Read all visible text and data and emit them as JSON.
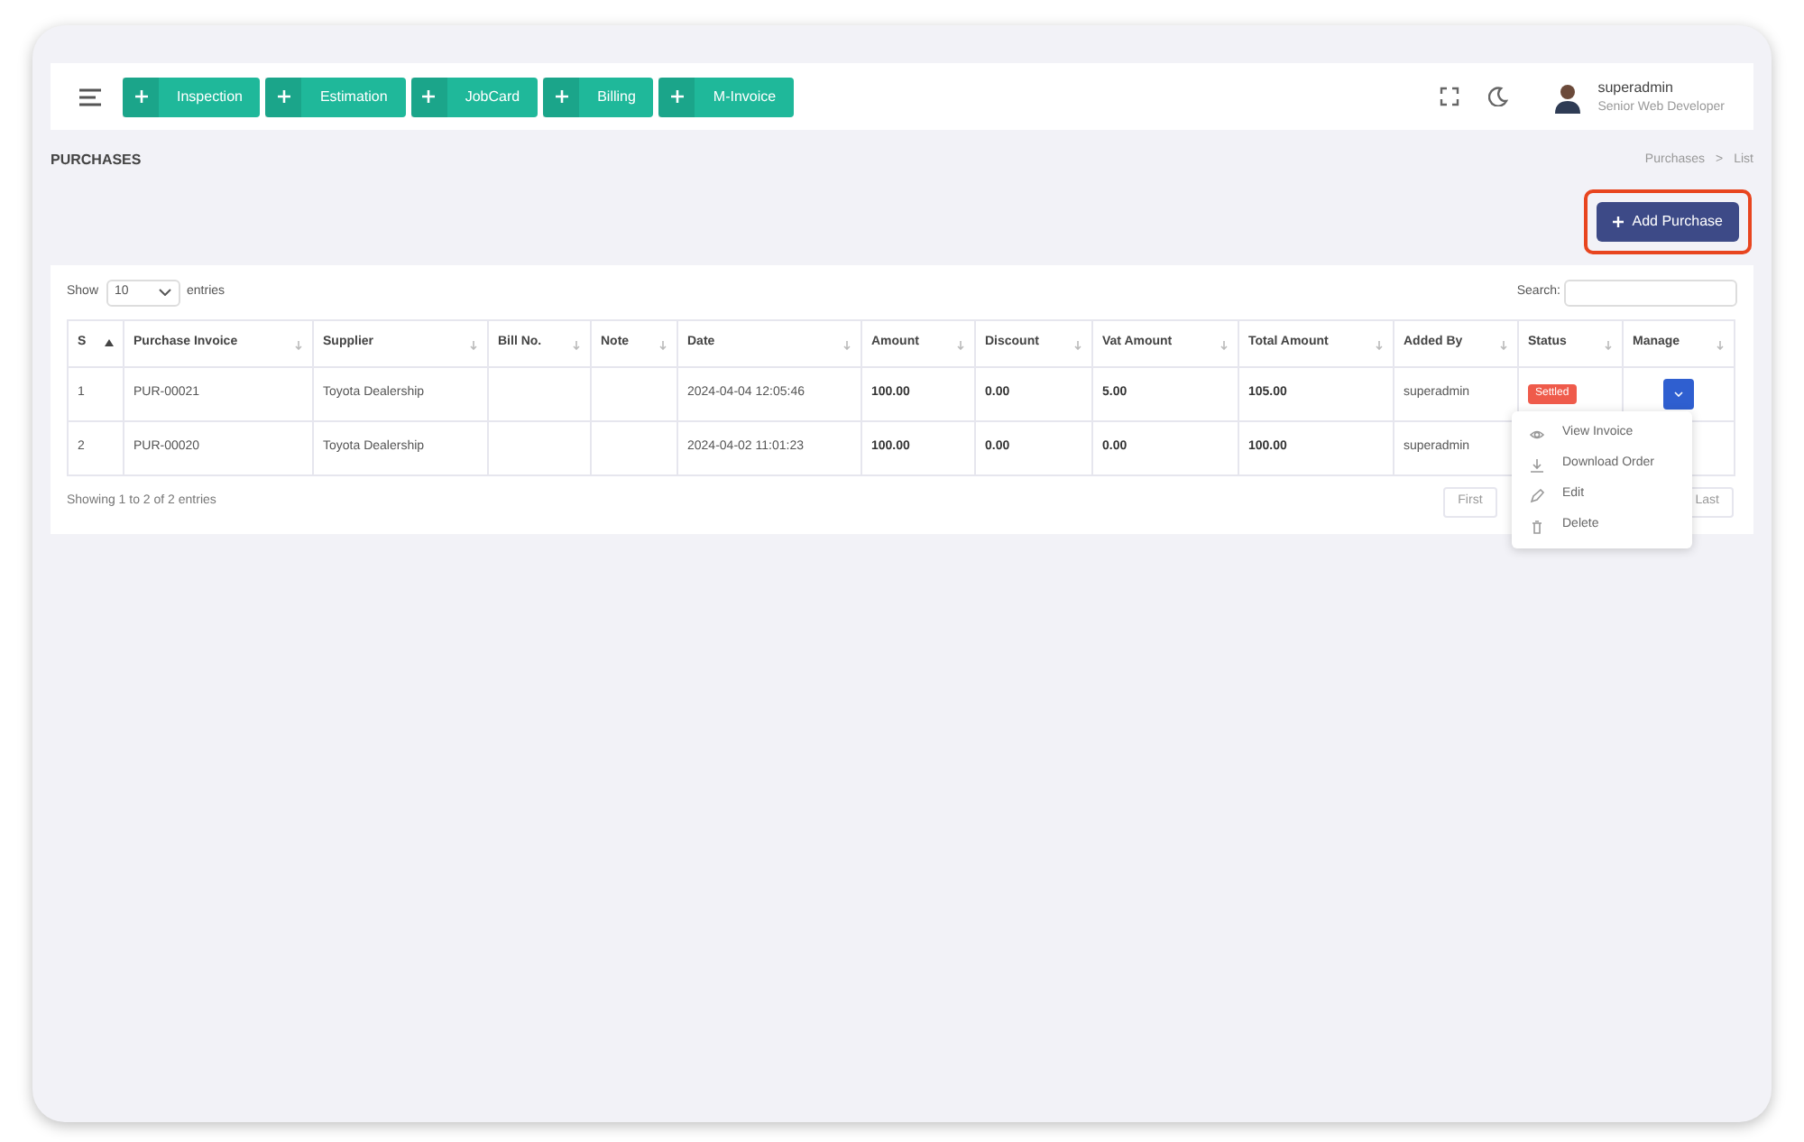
{
  "topbar": {
    "quick_buttons": [
      "Inspection",
      "Estimation",
      "JobCard",
      "Billing",
      "M-Invoice"
    ],
    "user": {
      "name": "superadmin",
      "role": "Senior Web Developer"
    }
  },
  "page_title": "PURCHASES",
  "breadcrumb": {
    "items": [
      "Purchases",
      "List"
    ],
    "separator": ">"
  },
  "add_button": {
    "label": "Add Purchase",
    "highlighted": true
  },
  "table": {
    "show_label": "Show",
    "page_size": "10",
    "entries_label": "entries",
    "search_label": "Search:",
    "columns": [
      {
        "label": "S",
        "sorted": true
      },
      {
        "label": "Purchase Invoice",
        "sorted": false
      },
      {
        "label": "Supplier",
        "sorted": false
      },
      {
        "label": "Bill No.",
        "sorted": false
      },
      {
        "label": "Note",
        "sorted": false
      },
      {
        "label": "Date",
        "sorted": false
      },
      {
        "label": "Amount",
        "sorted": false
      },
      {
        "label": "Discount",
        "sorted": false
      },
      {
        "label": "Vat Amount",
        "sorted": false
      },
      {
        "label": "Total Amount",
        "sorted": false
      },
      {
        "label": "Added By",
        "sorted": false
      },
      {
        "label": "Status",
        "sorted": false
      },
      {
        "label": "Manage",
        "sorted": false
      }
    ],
    "rows": [
      {
        "cells": [
          "1",
          "PUR-00021",
          "Toyota Dealership",
          "",
          "",
          "2024-04-04 12:05:46",
          "100.00",
          "0.00",
          "5.00",
          "105.00",
          "superadmin"
        ],
        "status": {
          "label": "Settled",
          "color": "#ef5b4b"
        },
        "manage_button": true
      },
      {
        "cells": [
          "2",
          "PUR-00020",
          "Toyota Dealership",
          "",
          "",
          "2024-04-02 11:01:23",
          "100.00",
          "0.00",
          "0.00",
          "100.00",
          "superadmin"
        ],
        "manage_button": false
      }
    ],
    "info": "Showing 1 to 2 of 2 entries",
    "pagination": [
      "First",
      "Last"
    ]
  },
  "action_menu": [
    {
      "kind": "view",
      "label": "View Invoice"
    },
    {
      "kind": "download",
      "label": "Download Order"
    },
    {
      "kind": "edit",
      "label": "Edit"
    },
    {
      "kind": "delete",
      "label": "Delete"
    }
  ]
}
